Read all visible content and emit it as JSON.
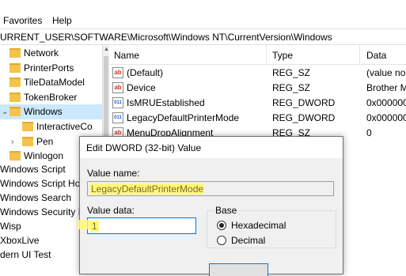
{
  "menu": {
    "items": [
      "Favorites",
      "Help"
    ]
  },
  "address": {
    "path": "URRENT_USER\\SOFTWARE\\Microsoft\\Windows NT\\CurrentVersion\\Windows"
  },
  "tree": {
    "items": [
      {
        "label": "Network"
      },
      {
        "label": "PrinterPorts"
      },
      {
        "label": "TileDataModel"
      },
      {
        "label": "TokenBroker"
      },
      {
        "label": "Windows"
      },
      {
        "label": "InteractiveCo"
      },
      {
        "label": "Pen"
      },
      {
        "label": "Winlogon"
      },
      {
        "label": "Windows Script"
      },
      {
        "label": "Windows Script Ho"
      },
      {
        "label": "Windows Search"
      },
      {
        "label": "Windows Security H"
      },
      {
        "label": "Wisp"
      },
      {
        "label": "XboxLive"
      },
      {
        "label": "dern UI Test"
      }
    ]
  },
  "list": {
    "columns": [
      "Name",
      "Type",
      "Data"
    ],
    "rows": [
      {
        "icon": "ab",
        "name": "(Default)",
        "type": "REG_SZ",
        "data": "(value no"
      },
      {
        "icon": "ab",
        "name": "Device",
        "type": "REG_SZ",
        "data": "Brother M"
      },
      {
        "icon": "011",
        "name": "IsMRUEstablished",
        "type": "REG_DWORD",
        "data": "0x000000"
      },
      {
        "icon": "011",
        "name": "LegacyDefaultPrinterMode",
        "type": "REG_DWORD",
        "data": "0x000000"
      },
      {
        "icon": "ab",
        "name": "MenuDropAlignment",
        "type": "REG_SZ",
        "data": "0"
      }
    ]
  },
  "dialog": {
    "title": "Edit DWORD (32-bit) Value",
    "value_name_label": "Value name:",
    "value_name": "LegacyDefaultPrinterMode",
    "value_data_label": "Value data:",
    "value_data": "1",
    "base_label": "Base",
    "base_options": [
      {
        "label": "Hexadecimal",
        "selected": true
      },
      {
        "label": "Decimal",
        "selected": false
      }
    ]
  },
  "colors": {
    "highlight": "#fff87a",
    "selection": "#cce8ff",
    "accent": "#0078d7"
  }
}
